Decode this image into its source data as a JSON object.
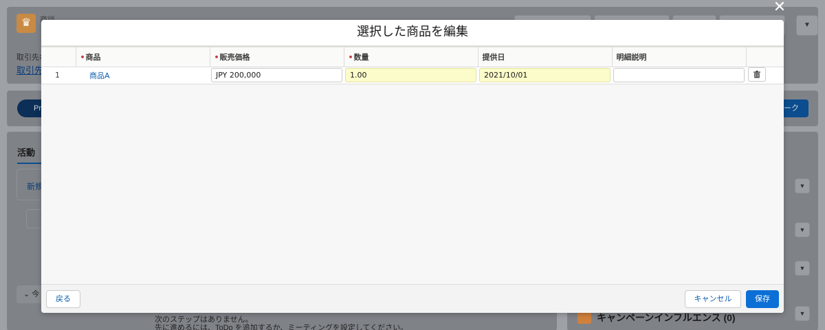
{
  "background": {
    "app_name": "商談",
    "app_icon": "crown-icon",
    "account_label": "取引先名",
    "account_link": "取引先",
    "path_pill": "Pr",
    "path_button": "ーク",
    "activity_tab": "活動",
    "new_label": "新規",
    "today_label": "今",
    "no_next_steps": "次のステップはありません。",
    "no_next_hint": "先に進めるには、ToDo を追加するか、ミーティングを設定してください。",
    "campaign_label": "キャンペーンインフルエンス (0)"
  },
  "modal": {
    "title": "選択した商品を編集",
    "close_icon": "close-icon",
    "columns": [
      {
        "label": "商品",
        "required": true
      },
      {
        "label": "販売価格",
        "required": true
      },
      {
        "label": "数量",
        "required": true
      },
      {
        "label": "提供日",
        "required": false
      },
      {
        "label": "明細説明",
        "required": false
      }
    ],
    "rows": [
      {
        "index": "1",
        "product": "商品A",
        "sales_price": "JPY 200,000",
        "quantity": "1.00",
        "service_date": "2021/10/01",
        "description": "",
        "delete_icon": "trash-icon"
      }
    ],
    "footer": {
      "back_label": "戻る",
      "cancel_label": "キャンセル",
      "save_label": "保存"
    }
  },
  "colors": {
    "brand": "#0b6fd6",
    "link": "#0b5cab",
    "highlight": "#fcfcca",
    "required": "#c23934"
  }
}
